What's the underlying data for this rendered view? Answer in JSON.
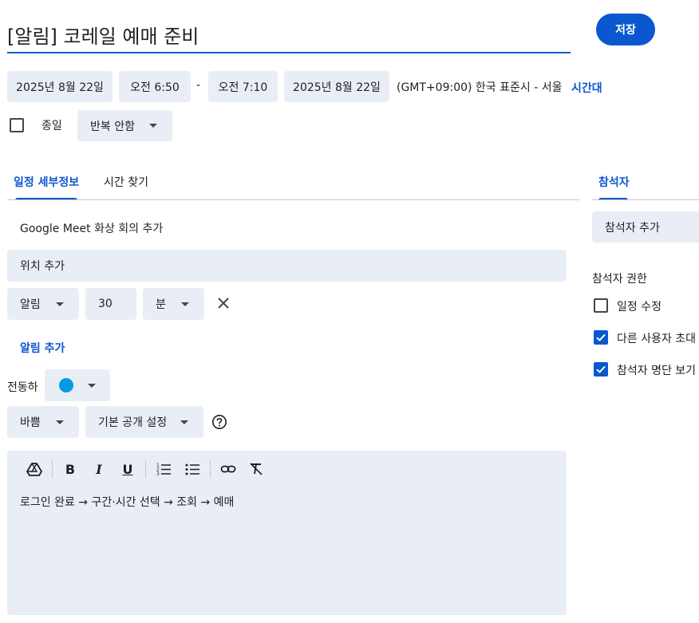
{
  "event": {
    "title": "[알림] 코레일 예매 준비",
    "save_label": "저장"
  },
  "datetime": {
    "start_date": "2025년 8월 22일",
    "start_time": "오전 6:50",
    "separator": "-",
    "end_time": "오전 7:10",
    "end_date": "2025년 8월 22일",
    "timezone": "(GMT+09:00) 한국 표준시 - 서울",
    "timezone_link": "시간대",
    "all_day_label": "종일",
    "all_day_checked": false,
    "repeat": "반복 안함"
  },
  "tabs": [
    {
      "label": "일정 세부정보",
      "active": true
    },
    {
      "label": "시간 찾기",
      "active": false
    }
  ],
  "details": {
    "meet_label": "Google Meet 화상 회의 추가",
    "location_placeholder": "위치 추가",
    "notification_type": "알림",
    "notification_value": "30",
    "notification_unit": "분",
    "add_notification": "알림 추가",
    "calendar_owner": "전동하",
    "calendar_color": "#039be5",
    "busy_status": "바쁨",
    "visibility": "기본 공개 설정",
    "description": "로그인 완료 → 구간·시간 선택 → 조회 → 예매"
  },
  "guests": {
    "tab_label": "참석자",
    "add_placeholder": "참석자 추가",
    "permissions_title": "참석자 권한",
    "permissions": [
      {
        "label": "일정 수정",
        "checked": false
      },
      {
        "label": "다른 사용자 초대",
        "checked": true
      },
      {
        "label": "참석자 명단 보기",
        "checked": true
      }
    ]
  },
  "colors": {
    "accent": "#0b57d0",
    "field_bg": "#e9eef6",
    "text": "#1f1f1f"
  }
}
